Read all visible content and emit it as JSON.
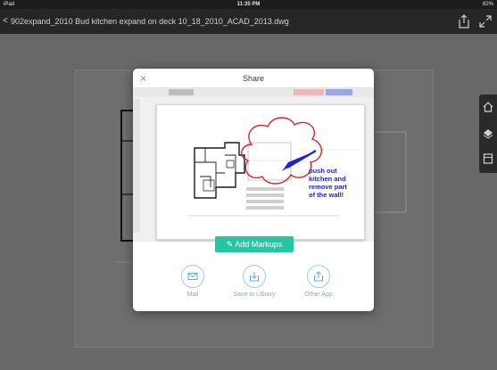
{
  "status_bar": {
    "device": "iPad",
    "time": "11:35 PM",
    "battery": "82%"
  },
  "title_bar": {
    "back_label": "<",
    "file_title": "902expand_2010 Bud kitchen expand on deck 10_18_2010_ACAD_2013.dwg"
  },
  "right_toolbar": {
    "icons": [
      "home-icon",
      "layers-icon",
      "sheets-icon"
    ]
  },
  "share_dialog": {
    "title": "Share",
    "close_label": "×",
    "preview_annotation": [
      "push out",
      "kitchen and",
      "remove part",
      "of the wall!"
    ],
    "add_markups_label": "✎ Add Markups",
    "options": [
      {
        "label": "Mail",
        "icon": "mail-icon"
      },
      {
        "label": "Save to Library",
        "icon": "save-to-library-icon"
      },
      {
        "label": "Other App",
        "icon": "other-app-icon"
      }
    ]
  },
  "colors": {
    "accent": "#26c6a5",
    "annotation": "#1e22d8",
    "cloud": "#d7262b",
    "option_ring": "#9ccbed"
  }
}
